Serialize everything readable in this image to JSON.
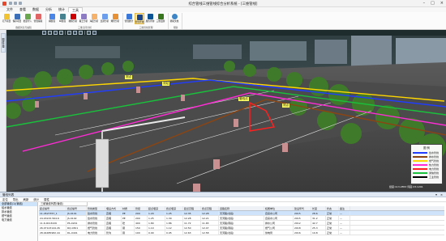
{
  "window": {
    "title": "综合管线三维管线综合分析系统 - [三维管线]",
    "controls": [
      "–",
      "□",
      "×"
    ]
  },
  "menu": [
    "文件",
    "查看",
    "数据",
    "分析",
    "统计",
    "工具"
  ],
  "ribbon": {
    "groups": [
      {
        "title": "数据浏览与编辑",
        "buttons": [
          "打开项目",
          "保存项目",
          "批量导入",
          "管线编辑"
        ]
      },
      {
        "title": "三维空间分析",
        "buttons": [
          "横断面",
          "纵断面",
          "碰撞分析",
          "覆土分析",
          "净距分析",
          "连通分析",
          "爆管分析"
        ]
      },
      {
        "title": "三维管线管理",
        "buttons": [
          "管线统计",
          "管线查询",
          "属性查询",
          "三维漫游"
        ]
      },
      {
        "title": "帮助",
        "buttons": [
          "帮助文档"
        ]
      }
    ],
    "selected_button": "管线查询"
  },
  "sidebar": {
    "tab": "图层管理"
  },
  "scene_labels": [
    "测点",
    "测站",
    "管线点",
    "测点"
  ],
  "legend": {
    "title": "图 例",
    "items": [
      {
        "label": "给水管线",
        "color": "#1f3cff"
      },
      {
        "label": "排水管线",
        "color": "#8b4513"
      },
      {
        "label": "燃气管线",
        "color": "#ffd700"
      },
      {
        "label": "热力管线",
        "color": "#ff2bd6"
      },
      {
        "label": "电力管线",
        "color": "#ff2020"
      },
      {
        "label": "通信管线",
        "color": "#19c23b"
      },
      {
        "label": "工业管线",
        "color": "#000000"
      }
    ]
  },
  "status": {
    "coords": "经度:113.2853 纬度:23.1291"
  },
  "bottom": {
    "title": "管线列表",
    "toolbar": [
      "定位",
      "导出",
      "刷新",
      "统计",
      "属性"
    ],
    "tree": [
      "全部管线(1)(管线)",
      "给水管线",
      "排水管线",
      "燃气管线",
      "电力管线"
    ],
    "grid_tab": "三维管线列表(管线)",
    "columns": [
      "起点编号",
      "终点编号",
      "管线类型",
      "埋设方式",
      "材质",
      "管径",
      "起点埋深",
      "终点埋深",
      "起点高程",
      "终点高程",
      "道路名称",
      "权属单位",
      "建设年代",
      "长度",
      "状态",
      "备注"
    ],
    "rows": [
      [
        "11-4527357_1",
        "JS-0101",
        "给水管线",
        "直埋",
        "PE",
        "200",
        "1.20",
        "1.25",
        "12.35",
        "12.28",
        "天河路(北段)",
        "自来水公司",
        "2015",
        "28.6",
        "正常",
        "—"
      ],
      [
        "24.03215.564.6",
        "JS-0102",
        "给水管线",
        "直埋",
        "PE",
        "200",
        "1.25",
        "1.30",
        "12.28",
        "12.21",
        "天河路(北段)",
        "自来水公司",
        "2015",
        "31.2",
        "正常",
        "—"
      ],
      [
        "11.6.0013226",
        "PS-0201",
        "排水管线",
        "直埋",
        "砼",
        "400",
        "1.80",
        "1.86",
        "11.72",
        "11.65",
        "天河路(南段)",
        "排水公司",
        "2012",
        "42.7",
        "正常",
        "—"
      ],
      [
        "26.07123144.26",
        "RQ-0301",
        "燃气管线",
        "直埋",
        "钢",
        "150",
        "1.10",
        "1.12",
        "12.50",
        "12.47",
        "天河路(南段)",
        "燃气公司",
        "2018",
        "25.3",
        "正常",
        "—"
      ],
      [
        "28.04485982.44",
        "DL-0401",
        "电力管线",
        "管沟",
        "铜",
        "100",
        "0.90",
        "0.95",
        "12.63",
        "12.58",
        "天河路(北段)",
        "供电局",
        "2016",
        "19.8",
        "正常",
        "—"
      ]
    ],
    "selected_row": 0
  }
}
